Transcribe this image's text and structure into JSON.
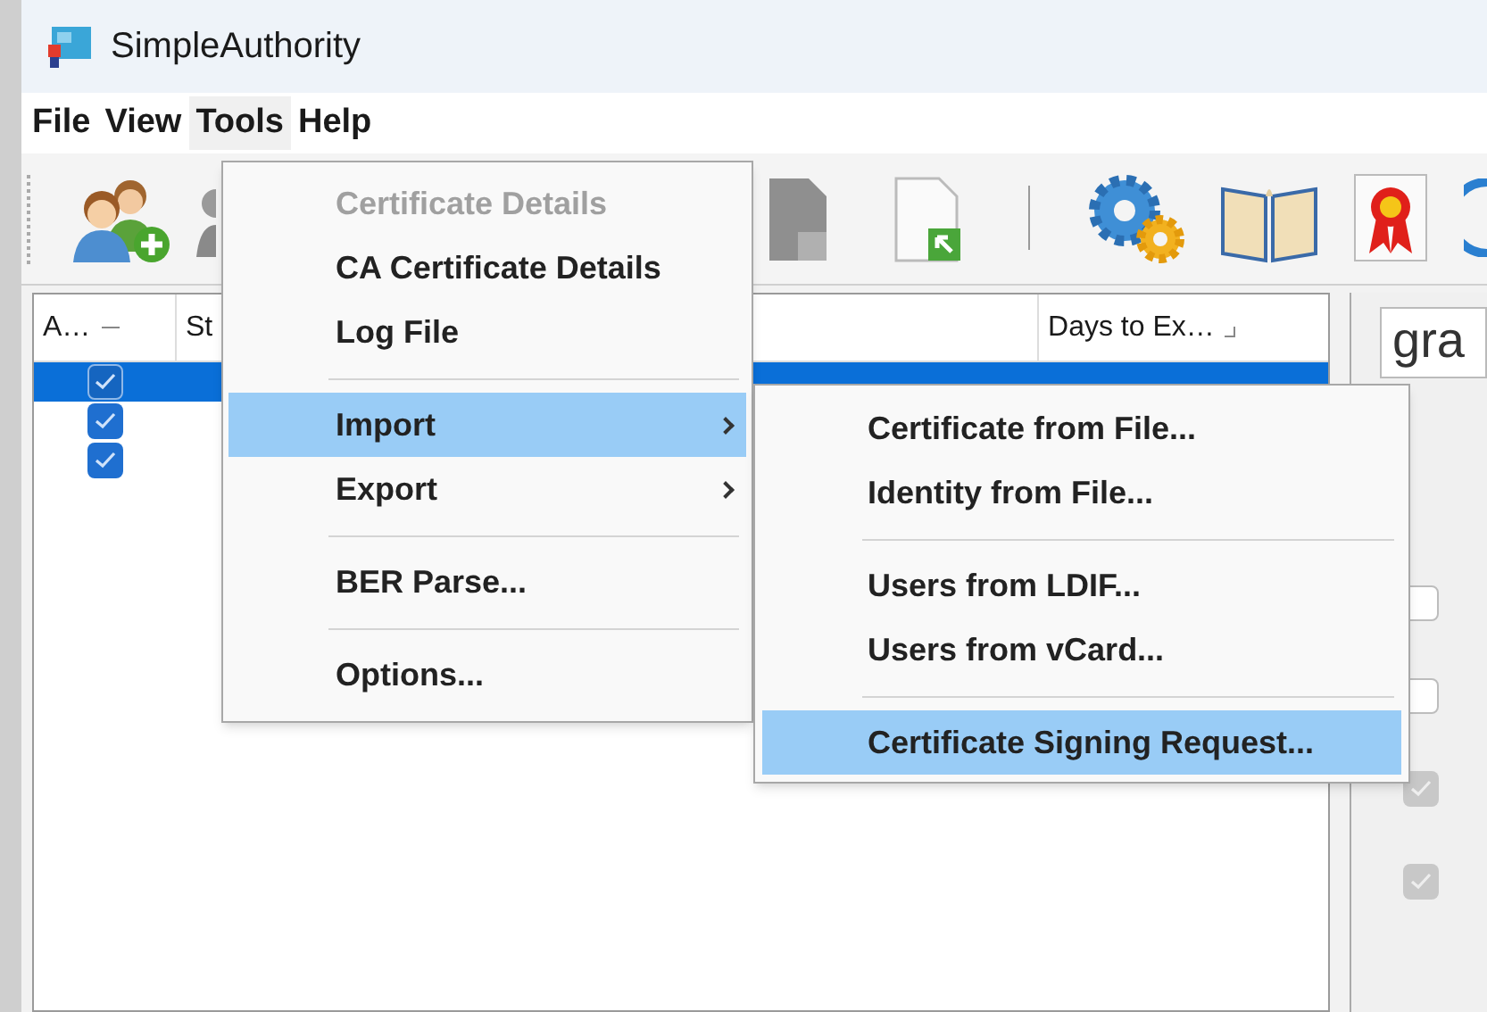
{
  "window": {
    "title": "SimpleAuthority"
  },
  "menu_bar": [
    {
      "label": "File",
      "selected": false
    },
    {
      "label": "View",
      "selected": false
    },
    {
      "label": "Tools",
      "selected": true
    },
    {
      "label": "Help",
      "selected": false
    }
  ],
  "table": {
    "columns": [
      {
        "label": "A…"
      },
      {
        "label": "St"
      },
      {
        "label": "Days to Ex…"
      }
    ],
    "rows": [
      {
        "checked": true,
        "selected": true
      },
      {
        "checked": true,
        "selected": false
      },
      {
        "checked": true,
        "selected": false
      }
    ]
  },
  "tools_menu": [
    {
      "kind": "item",
      "label": "Certificate Details",
      "disabled": true,
      "selected": false,
      "submenu": false
    },
    {
      "kind": "item",
      "label": "CA Certificate Details",
      "disabled": false,
      "selected": false,
      "submenu": false
    },
    {
      "kind": "item",
      "label": "Log File",
      "disabled": false,
      "selected": false,
      "submenu": false
    },
    {
      "kind": "separator"
    },
    {
      "kind": "item",
      "label": "Import",
      "disabled": false,
      "selected": true,
      "submenu": true
    },
    {
      "kind": "item",
      "label": "Export",
      "disabled": false,
      "selected": false,
      "submenu": true
    },
    {
      "kind": "separator"
    },
    {
      "kind": "item",
      "label": "BER Parse...",
      "disabled": false,
      "selected": false,
      "submenu": false
    },
    {
      "kind": "separator"
    },
    {
      "kind": "item",
      "label": "Options...",
      "disabled": false,
      "selected": false,
      "submenu": false
    }
  ],
  "import_submenu": [
    {
      "kind": "item",
      "label": "Certificate from File...",
      "disabled": false,
      "selected": false,
      "submenu": false
    },
    {
      "kind": "item",
      "label": "Identity from File...",
      "disabled": false,
      "selected": false,
      "submenu": false
    },
    {
      "kind": "separator"
    },
    {
      "kind": "item",
      "label": "Users from LDIF...",
      "disabled": false,
      "selected": false,
      "submenu": false
    },
    {
      "kind": "item",
      "label": "Users from vCard...",
      "disabled": false,
      "selected": false,
      "submenu": false
    },
    {
      "kind": "separator"
    },
    {
      "kind": "item",
      "label": "Certificate Signing Request...",
      "disabled": false,
      "selected": true,
      "submenu": false
    }
  ],
  "right_panel": {
    "field_text": "gra",
    "checkboxes": [
      {
        "checked": false,
        "disabled": false
      },
      {
        "checked": false,
        "disabled": false
      },
      {
        "checked": true,
        "disabled": true
      },
      {
        "checked": true,
        "disabled": true
      }
    ]
  }
}
